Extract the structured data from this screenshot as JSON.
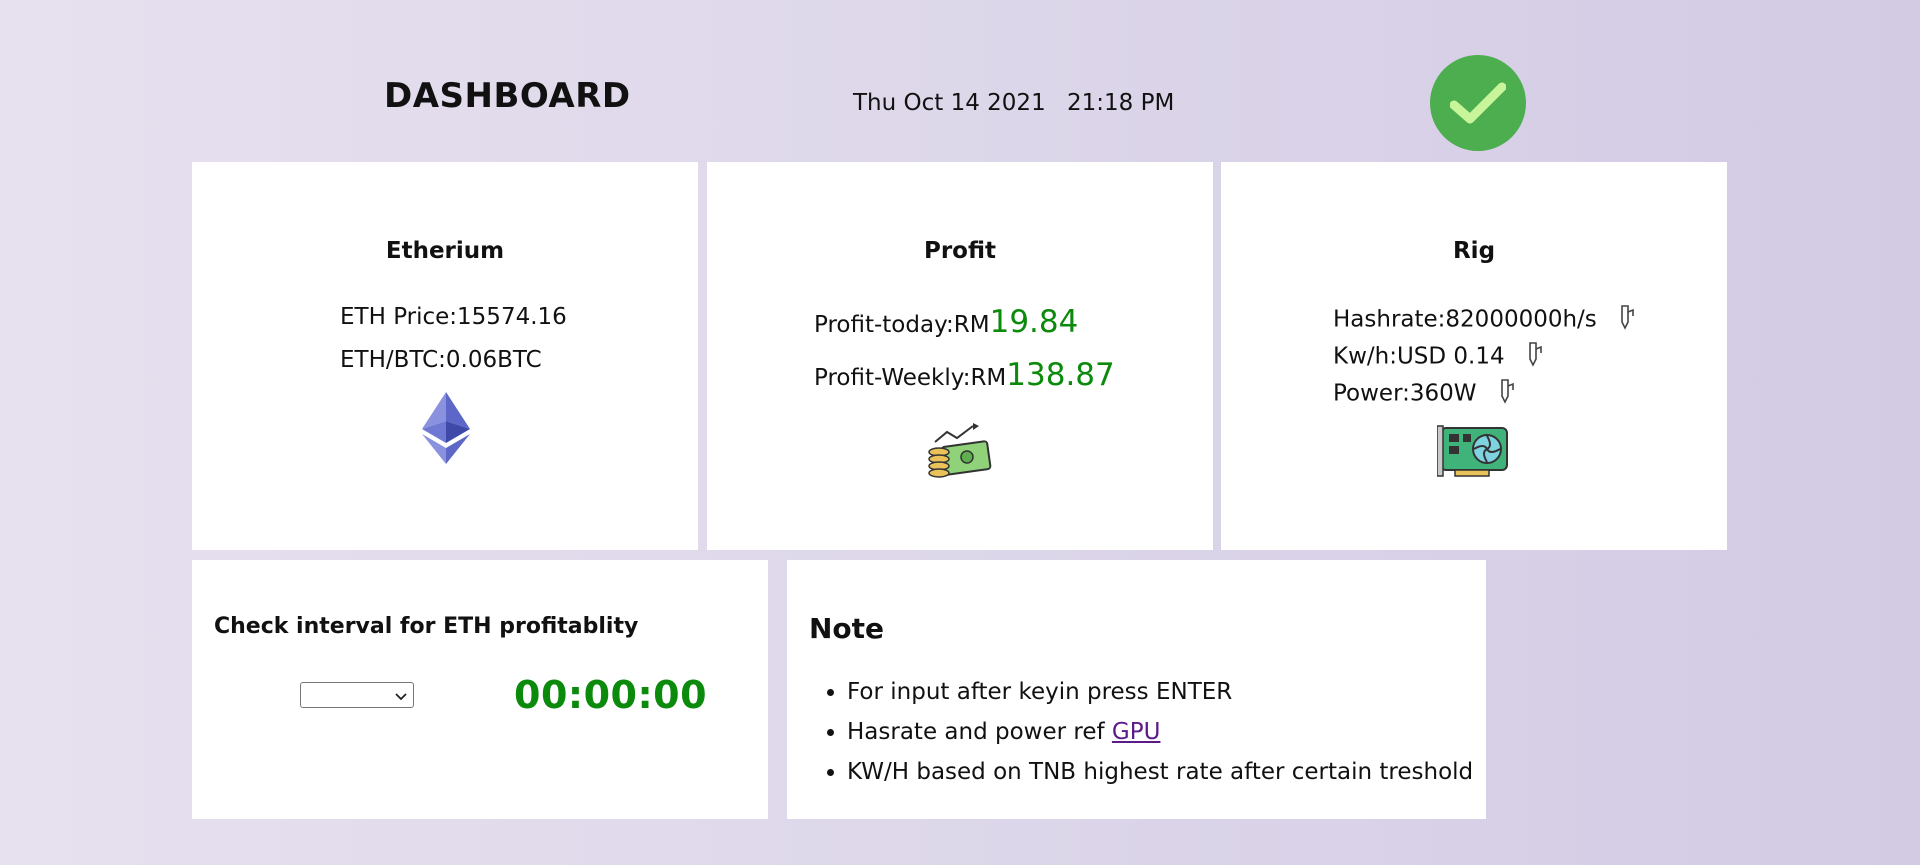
{
  "header": {
    "title": "DASHBOARD",
    "date": "Thu Oct 14 2021",
    "time": "21:18 PM",
    "status_icon": "checkmark-icon",
    "status_color": "#4cae4f"
  },
  "ethereum": {
    "heading": "Etherium",
    "price_label": "ETH Price:15574.16",
    "btc_label": "ETH/BTC:0.06BTC",
    "icon": "ethereum-icon"
  },
  "profit": {
    "heading": "Profit",
    "today_label": "Profit-today:RM",
    "today_value": "19.84",
    "weekly_label": "Profit-Weekly:RM",
    "weekly_value": "138.87",
    "icon": "money-icon",
    "value_color": "#0c8a0c"
  },
  "rig": {
    "heading": "Rig",
    "hashrate": "Hashrate:82000000h/s",
    "kwh": "Kw/h:USD 0.14",
    "power": "Power:360W",
    "icon": "gpu-card-icon"
  },
  "interval": {
    "heading": "Check interval for ETH profitablity",
    "select_value": "",
    "timer": "00:00:00"
  },
  "note": {
    "heading": "Note",
    "items": [
      "For input after keyin press ENTER",
      "Hasrate and power ref ",
      "KW/H based on TNB highest rate after certain treshold"
    ],
    "link_text": "GPU"
  }
}
